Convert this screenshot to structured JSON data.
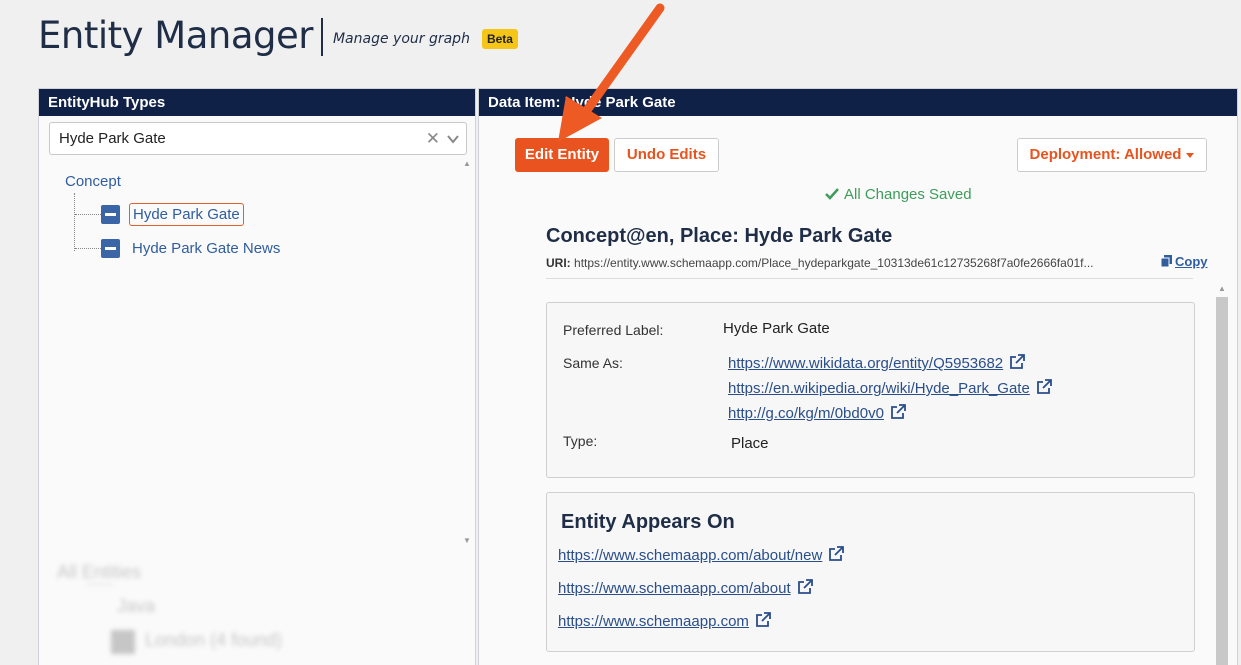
{
  "header": {
    "title": "Entity Manager",
    "subtitle": "Manage your graph",
    "badge": "Beta"
  },
  "left_panel": {
    "title": "EntityHub Types",
    "select_value": "Hyde Park Gate",
    "tree_root": "Concept",
    "tree_items": [
      "Hyde Park Gate",
      "Hyde Park Gate News"
    ],
    "blurred": {
      "root": "All Entities",
      "child": "Java",
      "item": "London (4 found)"
    }
  },
  "right_panel": {
    "title": "Data Item: Hyde Park Gate",
    "edit_button": "Edit Entity",
    "undo_button": "Undo Edits",
    "deployment_button": "Deployment: Allowed",
    "saved_status": "All Changes Saved",
    "entity_title": "Concept@en, Place:  Hyde Park Gate",
    "uri_label": "URI:",
    "uri_value": "https://entity.www.schemaapp.com/Place_hydeparkgate_10313de61c12735268f7a0fe2666fa01f...",
    "copy_label": "Copy",
    "details": {
      "preferred_label_key": "Preferred Label:",
      "preferred_label_value": "Hyde Park Gate",
      "same_as_key": "Same As:",
      "same_as_links": [
        "https://www.wikidata.org/entity/Q5953682",
        "https://en.wikipedia.org/wiki/Hyde_Park_Gate",
        "http://g.co/kg/m/0bd0v0"
      ],
      "type_key": "Type:",
      "type_value": "Place"
    },
    "appears_on": {
      "title": "Entity Appears On",
      "links": [
        "https://www.schemaapp.com/about/new",
        "https://www.schemaapp.com/about",
        "https://www.schemaapp.com"
      ]
    }
  },
  "colors": {
    "navy": "#0f2147",
    "accent": "#e8531f",
    "link": "#2a4e8a",
    "success": "#3e9c5a",
    "badge": "#f5c518"
  },
  "icons": [
    "close-icon",
    "chevron-down-icon",
    "collapse-icon",
    "check-icon",
    "copy-icon",
    "external-link-icon",
    "caret-down-icon",
    "annotation-arrow"
  ]
}
